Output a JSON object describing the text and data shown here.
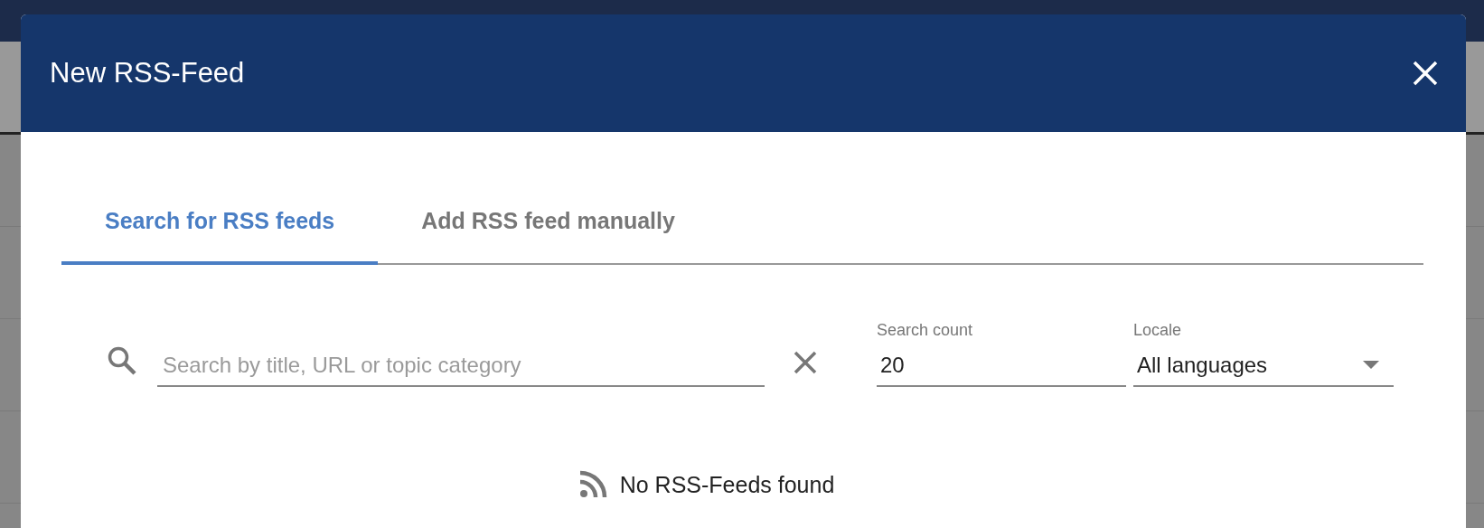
{
  "dialog": {
    "title": "New RSS-Feed"
  },
  "tabs": [
    {
      "label": "Search for RSS feeds",
      "selected": true
    },
    {
      "label": "Add RSS feed manually",
      "selected": false
    }
  ],
  "search": {
    "placeholder": "Search by title, URL or topic category"
  },
  "search_count": {
    "label": "Search count",
    "value": "20"
  },
  "locale": {
    "label": "Locale",
    "value": "All languages"
  },
  "empty_message": "No RSS-Feeds found"
}
